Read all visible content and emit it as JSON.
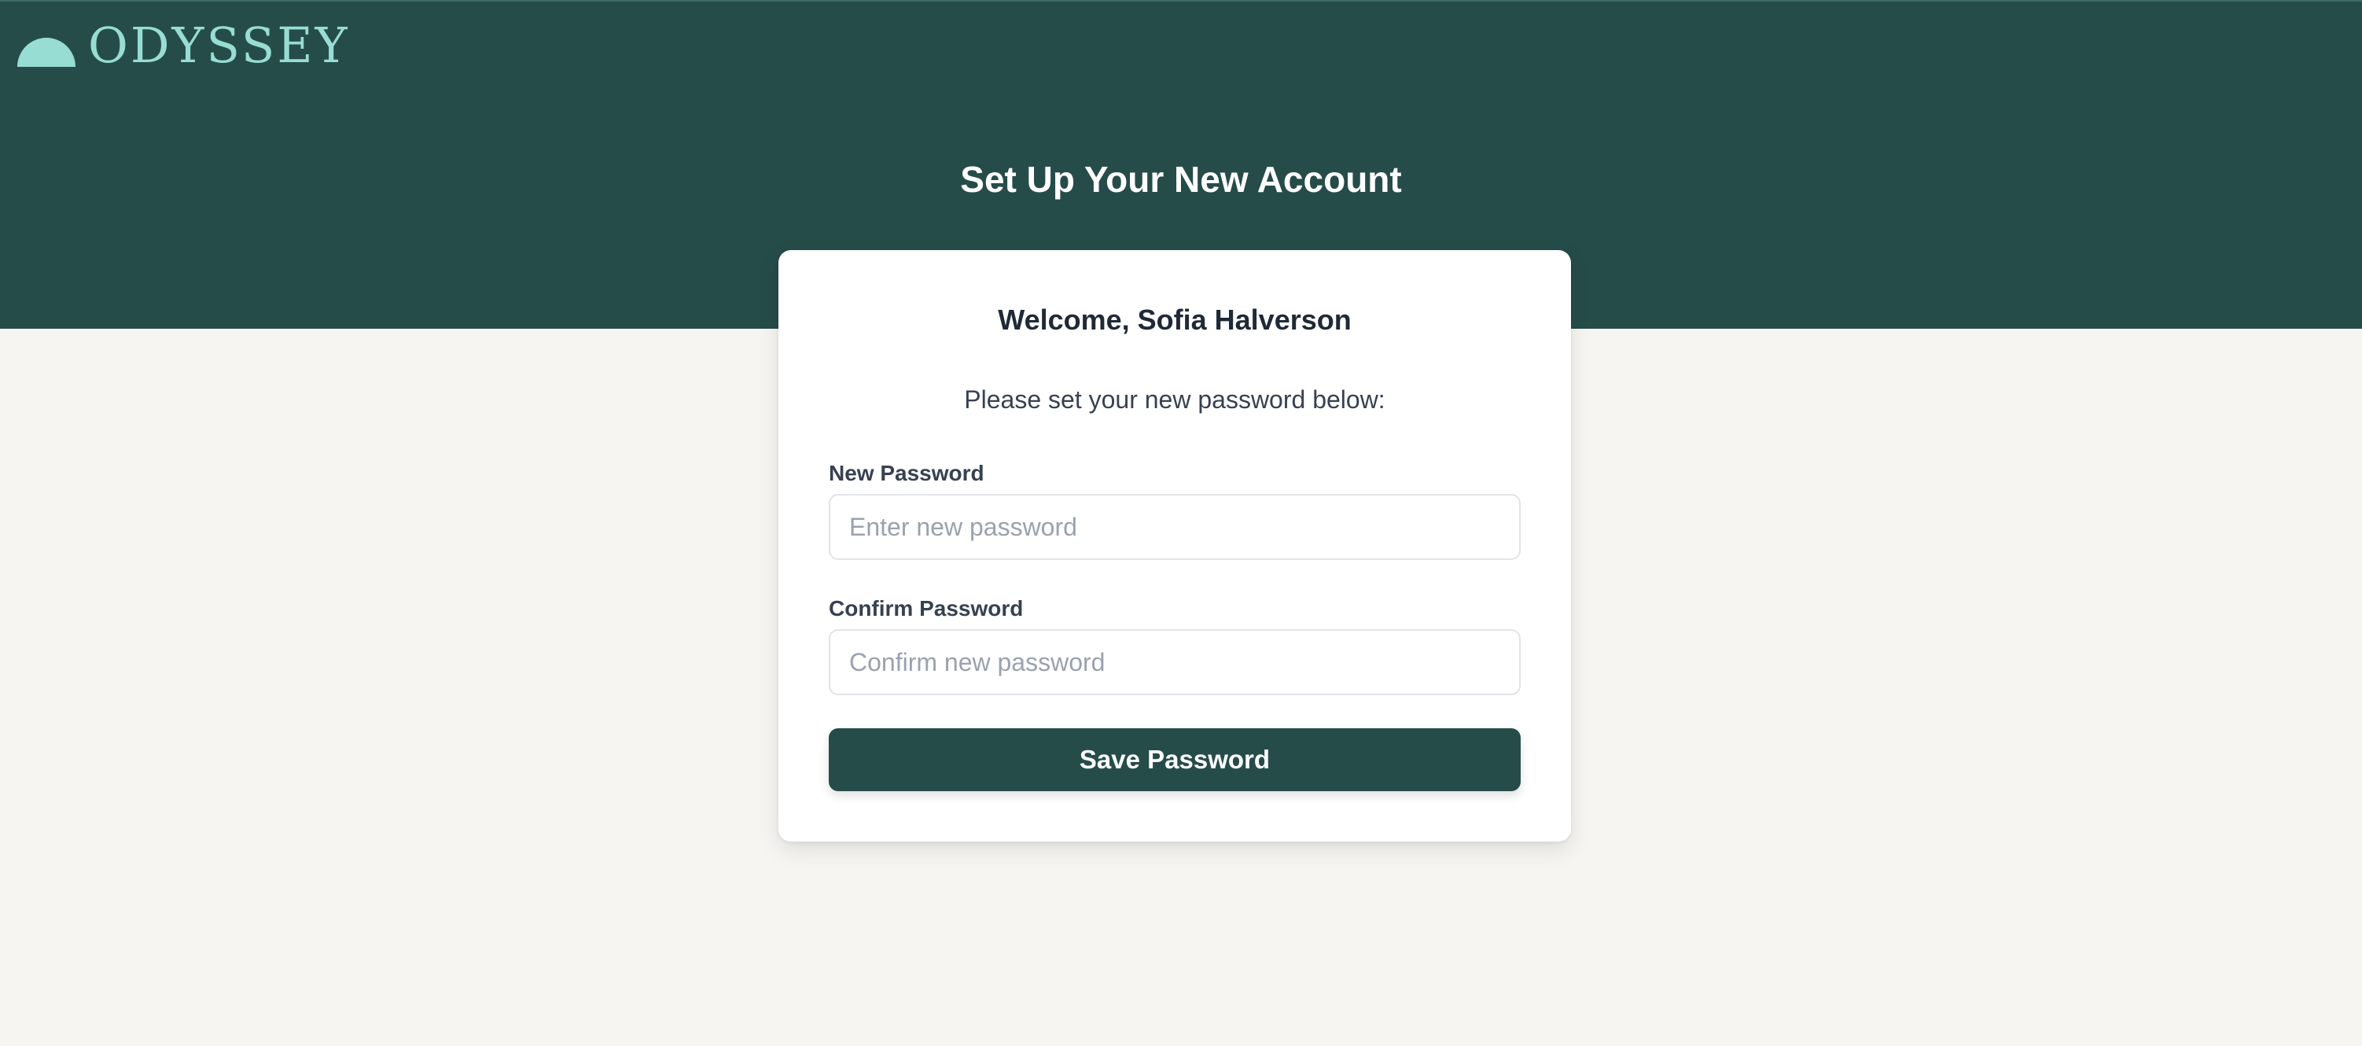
{
  "brand": {
    "name": "ODYSSEY",
    "logo_icon": "half-circle-icon",
    "color": "#97ddd3"
  },
  "header": {
    "title": "Set Up Your New Account",
    "background": "#264c4a"
  },
  "card": {
    "welcome": "Welcome, Sofia Halverson",
    "instruction": "Please set your new password below:",
    "new_password": {
      "label": "New Password",
      "value": "",
      "placeholder": "Enter new password"
    },
    "confirm_password": {
      "label": "Confirm Password",
      "value": "",
      "placeholder": "Confirm new password"
    },
    "save_label": "Save Password"
  },
  "colors": {
    "accent": "#264c4a",
    "page_background": "#f6f5f1"
  }
}
